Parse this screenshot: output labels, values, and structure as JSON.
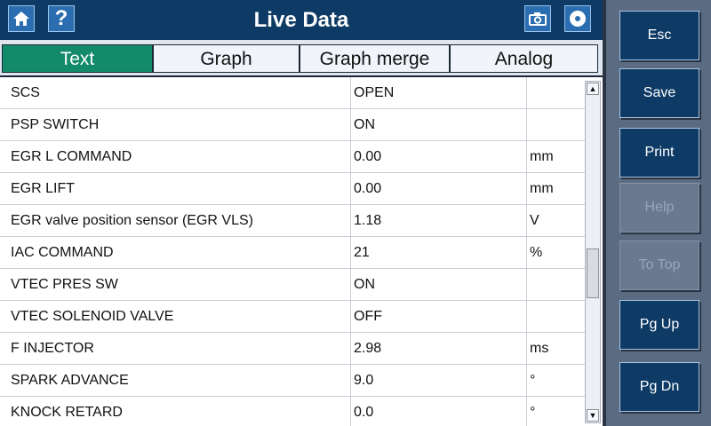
{
  "window": {
    "title": "Live Data"
  },
  "titlebar_icons": {
    "home": "home-icon",
    "help": "question-icon",
    "camera": "camera-icon",
    "disc": "disc-icon"
  },
  "tabs": [
    {
      "label": "Text",
      "active": true
    },
    {
      "label": "Graph",
      "active": false
    },
    {
      "label": "Graph merge",
      "active": false
    },
    {
      "label": "Analog",
      "active": false
    }
  ],
  "rows": [
    {
      "name": "SCS",
      "value": "OPEN",
      "unit": ""
    },
    {
      "name": "PSP SWITCH",
      "value": "ON",
      "unit": ""
    },
    {
      "name": "EGR L COMMAND",
      "value": "0.00",
      "unit": "mm"
    },
    {
      "name": "EGR LIFT",
      "value": "0.00",
      "unit": "mm"
    },
    {
      "name": "EGR valve position sensor (EGR VLS)",
      "value": "1.18",
      "unit": "V"
    },
    {
      "name": "IAC COMMAND",
      "value": "21",
      "unit": "%"
    },
    {
      "name": "VTEC PRES SW",
      "value": "ON",
      "unit": ""
    },
    {
      "name": "VTEC SOLENOID VALVE",
      "value": "OFF",
      "unit": ""
    },
    {
      "name": "F INJECTOR",
      "value": "2.98",
      "unit": "ms"
    },
    {
      "name": "SPARK ADVANCE",
      "value": "9.0",
      "unit": "°"
    },
    {
      "name": "KNOCK RETARD",
      "value": "0.0",
      "unit": "°"
    }
  ],
  "scrollbar": {
    "up_glyph": "▲",
    "down_glyph": "▼"
  },
  "side_buttons": [
    {
      "label": "Esc",
      "enabled": true
    },
    {
      "label": "Save",
      "enabled": true
    },
    {
      "label": "Print",
      "enabled": true
    },
    {
      "label": "Help",
      "enabled": false
    },
    {
      "label": "To Top",
      "enabled": false
    },
    {
      "label": "Pg Up",
      "enabled": true
    },
    {
      "label": "Pg Dn",
      "enabled": true
    }
  ],
  "colors": {
    "title_bar": "#0e3a66",
    "active_tab": "#138a6a",
    "side_button": "#0e3a66",
    "side_button_disabled": "#6a7890"
  }
}
